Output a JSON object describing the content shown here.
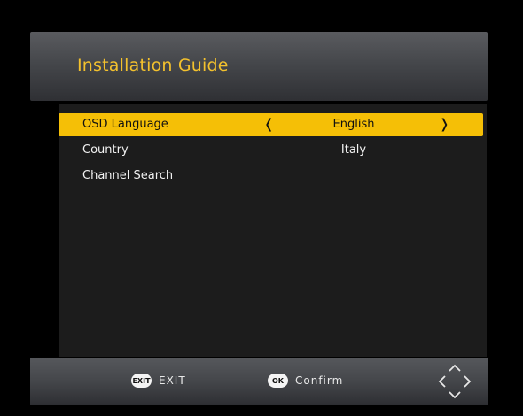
{
  "header": {
    "title": "Installation Guide"
  },
  "menu": {
    "items": [
      {
        "label": "OSD Language",
        "value": "English",
        "selected": true
      },
      {
        "label": "Country",
        "value": "Italy",
        "selected": false
      },
      {
        "label": "Channel Search",
        "value": "",
        "selected": false
      }
    ]
  },
  "footer": {
    "exit": {
      "icon_text": "EXIT",
      "label": "EXIT"
    },
    "confirm": {
      "icon_text": "OK",
      "label": "Confirm"
    }
  },
  "icons": {
    "prev": "chevron-left-icon",
    "next": "chevron-right-icon",
    "nav": "navigation-arrows-icon"
  },
  "colors": {
    "accent": "#f5bf06",
    "title": "#f3c12d"
  }
}
